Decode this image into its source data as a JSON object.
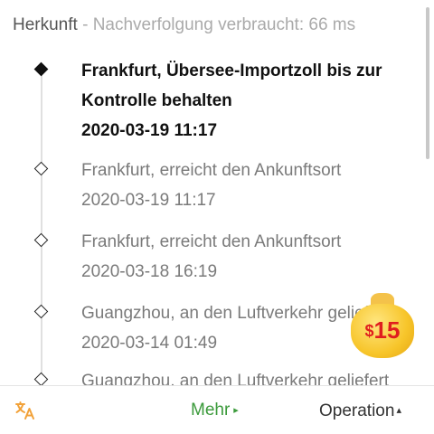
{
  "header": {
    "origin": "Herkunft",
    "separator": " - ",
    "trace_info": "Nachverfolgung verbraucht: 66 ms"
  },
  "events": [
    {
      "description": "Frankfurt, Übersee-Importzoll bis zur",
      "description_line2": "Kontrolle behalten",
      "time": "2020-03-19 11:17",
      "active": true
    },
    {
      "description": "Frankfurt, erreicht den Ankunftsort",
      "time": "2020-03-19 11:17",
      "active": false
    },
    {
      "description": "Frankfurt, erreicht den Ankunftsort",
      "time": "2020-03-18 16:19",
      "active": false
    },
    {
      "description": "Guangzhou, an den Luftverkehr geliefert",
      "time": "2020-03-14 01:49",
      "active": false
    },
    {
      "description": "Guangzhou, an den Luftverkehr geliefert",
      "active": false
    }
  ],
  "reward_badge": {
    "currency": "$",
    "amount": "15"
  },
  "footer": {
    "translate_icon": "translate-icon",
    "more_label": "Mehr",
    "more_arrow": "▸",
    "operation_label": "Operation",
    "operation_arrow": "▴"
  },
  "colors": {
    "accent_green": "#3b9a3b",
    "translate_orange": "#f2a23a",
    "badge_red": "#e01e1e",
    "badge_gold": "#f7c52a"
  }
}
